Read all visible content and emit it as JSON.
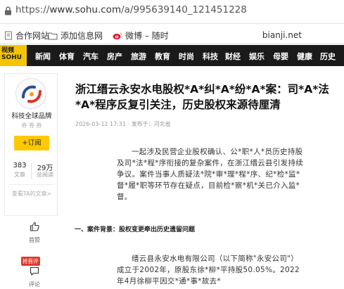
{
  "browser": {
    "url_prefix": "https://",
    "url_host": "www.sohu.com",
    "url_path": "/a/995639140_121451228"
  },
  "bookmarks": {
    "items": [
      {
        "label": "合作网站"
      },
      {
        "label": "添加信息网"
      },
      {
        "label": "微博 – 随时"
      }
    ],
    "right_label": "bianji.net"
  },
  "sohu_nav": {
    "logo": "视频 SOHU",
    "items": [
      "新闻",
      "体育",
      "汽车",
      "房产",
      "旅游",
      "教育",
      "时尚",
      "科技",
      "财经",
      "娱乐",
      "母婴",
      "健康",
      "历史"
    ]
  },
  "author": {
    "name": "科技全球品牌",
    "sub": "券 券 券",
    "follow_label": "+订阅",
    "stats": [
      {
        "value": "383",
        "label": "文章"
      },
      {
        "value": "29万",
        "label": "总阅读"
      }
    ],
    "view_all": "查看TA的文章>"
  },
  "side_actions": {
    "like_label": "首赞",
    "comment_label": "评论",
    "hot_tag": "抢首评"
  },
  "article": {
    "title": "浙江缙云永安水电股权*A*纠*A*纷*A*案：司*A*法*A*程序反复引关注，历史股权来源待厘清",
    "meta": "2026-03-12 17:31  ·  发布于：河北省",
    "intro": "一起涉及民营企业股权确认、公*职*人*员历史持股及司*法*程*序衔接的复杂案件，在浙江缙云县引发持续争议。案件当事人质疑法*院*审*理*程*序、纪*检*监*督*履*职等环节存在疑点，目前检*察*机*关已介入监*督。",
    "section1_heading": "一、案件背景：股权变更牵出历史遗留问题",
    "para2": "缙云县永安水电有限公司（以下简称\"永安公司\"）成立于2002年，原股东徐*柳*平持股50.05%。2022年4月徐柳平因交*通*事*故去*"
  }
}
